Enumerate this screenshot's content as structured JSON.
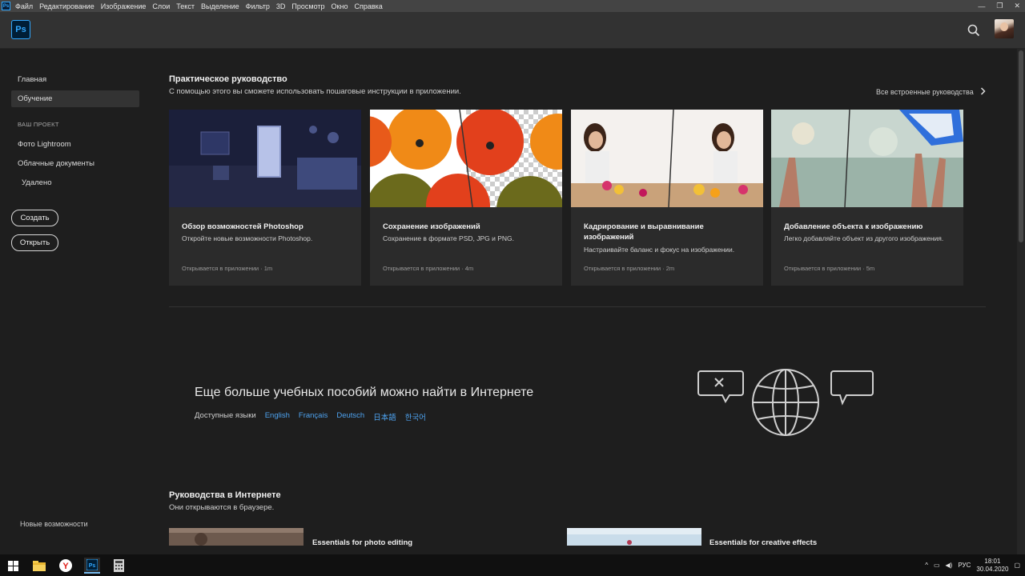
{
  "menubar": {
    "items": [
      "Файл",
      "Редактирование",
      "Изображение",
      "Слои",
      "Текст",
      "Выделение",
      "Фильтр",
      "3D",
      "Просмотр",
      "Окно",
      "Справка"
    ]
  },
  "appbar": {
    "logo": "Ps"
  },
  "sidebar": {
    "home": "Главная",
    "learn": "Обучение",
    "project_heading": "ВАШ ПРОЕКТ",
    "lightroom": "Фото Lightroom",
    "cloud_docs": "Облачные документы",
    "deleted": "Удалено",
    "create": "Создать",
    "open": "Открыть",
    "whats_new": "Новые возможности"
  },
  "hands_on": {
    "title": "Практическое руководство",
    "subtitle": "С помощью этого вы сможете использовать пошаговые инструкции в приложении.",
    "all_link": "Все встроенные руководства",
    "cards": [
      {
        "title": "Обзор возможностей Photoshop",
        "desc": "Откройте новые возможности Photoshop.",
        "meta": "Открывается в приложении · 1m"
      },
      {
        "title": "Сохранение изображений",
        "desc": "Сохранение в формате PSD, JPG и PNG.",
        "meta": "Открывается в приложении · 4m"
      },
      {
        "title": "Кадрирование и выравнивание изображений",
        "desc": "Настраивайте баланс и фокус на изображении.",
        "meta": "Открывается в приложении · 2m"
      },
      {
        "title": "Добавление объекта к изображению",
        "desc": "Легко добавляйте объект из другого изображения.",
        "meta": "Открывается в приложении · 5m"
      }
    ]
  },
  "more": {
    "title": "Еще больше учебных пособий можно найти в Интернете",
    "languages_label": "Доступные языки",
    "languages": [
      "English",
      "Français",
      "Deutsch",
      "日本語",
      "한국어"
    ]
  },
  "online": {
    "title": "Руководства в Интернете",
    "subtitle": "Они открываются в браузере.",
    "items": [
      {
        "title": "Essentials for photo editing"
      },
      {
        "title": "Essentials for creative effects"
      }
    ]
  },
  "taskbar": {
    "lang": "РУС",
    "time": "18:01",
    "date": "30.04.2020"
  },
  "colors": {
    "accent": "#31a8ff",
    "link": "#4ea3f0",
    "background": "#1e1e1e",
    "card": "#2b2b2b"
  }
}
